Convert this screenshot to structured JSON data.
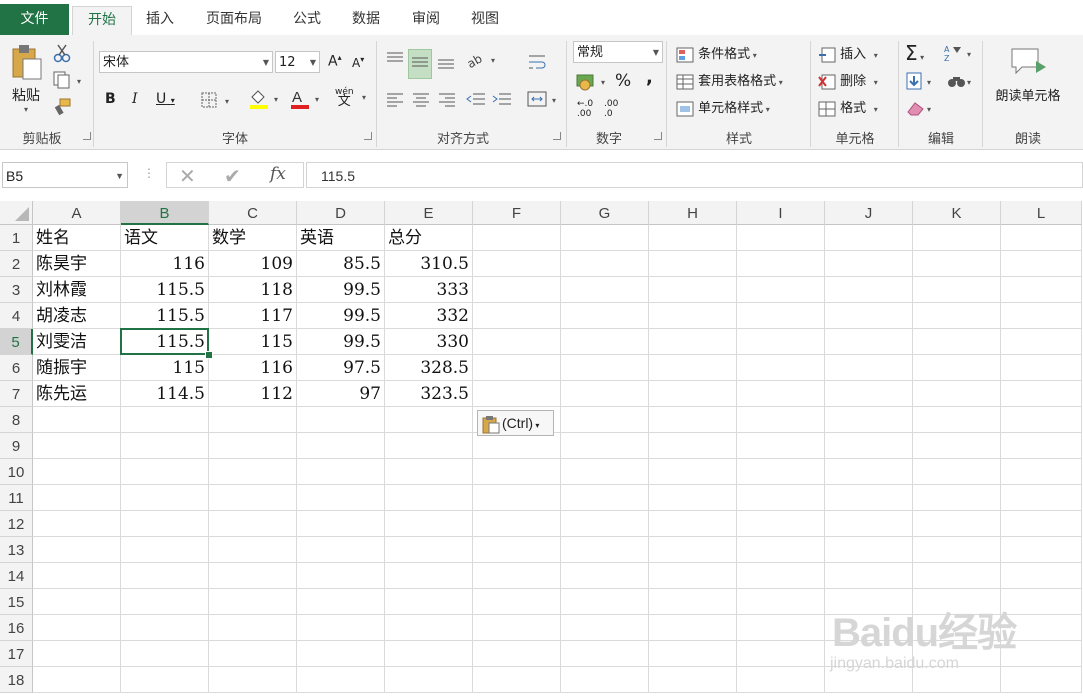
{
  "tabs": [
    "文件",
    "开始",
    "插入",
    "页面布局",
    "公式",
    "数据",
    "审阅",
    "视图"
  ],
  "ribbon": {
    "clipboard": {
      "paste": "粘贴",
      "label": "剪贴板"
    },
    "font": {
      "name": "宋体",
      "size": "12",
      "label": "字体",
      "bold": "B",
      "italic": "I",
      "underline": "U",
      "wen": "wén",
      "wen_char": "文"
    },
    "alignment": {
      "label": "对齐方式"
    },
    "number": {
      "format": "常规",
      "percent": "%",
      "comma": ",",
      "label": "数字",
      "inc_decimal": ".00",
      "dec_decimal": ".0"
    },
    "styles": {
      "conditional": "条件格式",
      "table": "套用表格格式",
      "cell": "单元格样式",
      "label": "样式"
    },
    "cells": {
      "insert": "插入",
      "delete": "删除",
      "format": "格式",
      "label": "单元格"
    },
    "editing": {
      "label": "编辑"
    },
    "read": {
      "button": "朗读单元格",
      "label": "朗读"
    }
  },
  "formula_bar": {
    "name_box": "B5",
    "fx": "fx",
    "value": "115.5"
  },
  "columns": [
    "A",
    "B",
    "C",
    "D",
    "E",
    "F",
    "G",
    "H",
    "I",
    "J",
    "K",
    "L"
  ],
  "selected": {
    "column": "B",
    "row": "5"
  },
  "rows": [
    "1",
    "2",
    "3",
    "4",
    "5",
    "6",
    "7",
    "8",
    "9",
    "10",
    "11",
    "12",
    "13",
    "14",
    "15",
    "16",
    "17",
    "18"
  ],
  "table": [
    [
      "姓名",
      "语文",
      "数学",
      "英语",
      "总分"
    ],
    [
      "陈昊宇",
      "116",
      "109",
      "85.5",
      "310.5"
    ],
    [
      "刘林霞",
      "115.5",
      "118",
      "99.5",
      "333"
    ],
    [
      "胡凌志",
      "115.5",
      "117",
      "99.5",
      "332"
    ],
    [
      "刘雯洁",
      "115.5",
      "115",
      "99.5",
      "330"
    ],
    [
      "随振宇",
      "115",
      "116",
      "97.5",
      "328.5"
    ],
    [
      "陈先运",
      "114.5",
      "112",
      "97",
      "323.5"
    ]
  ],
  "paste_options": {
    "label": "(Ctrl)"
  },
  "watermark": {
    "logo": "Baidu经验",
    "url": "jingyan.baidu.com"
  }
}
